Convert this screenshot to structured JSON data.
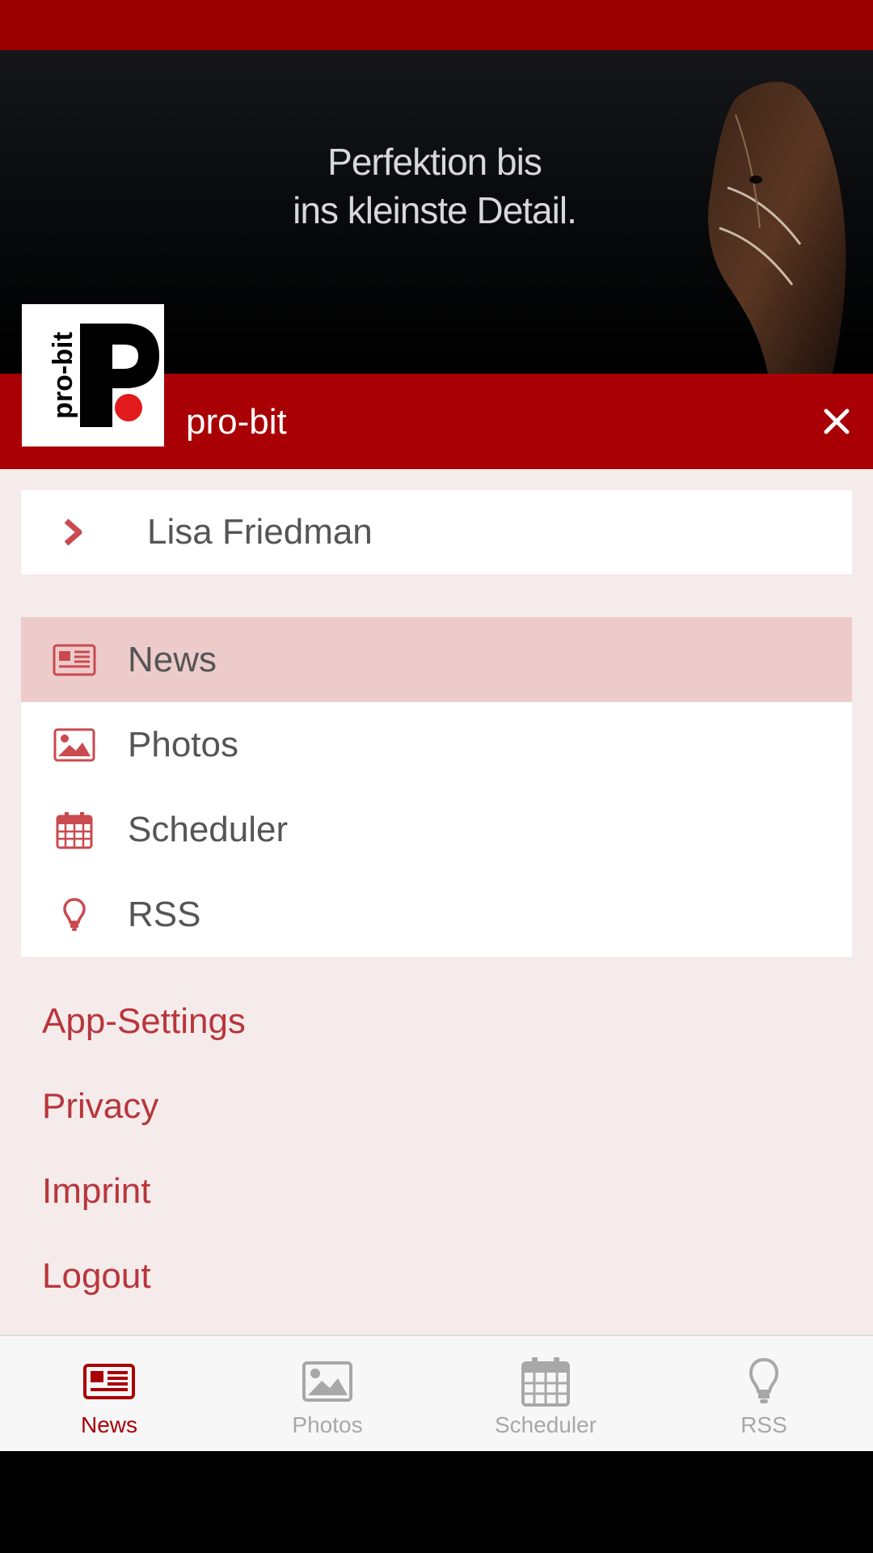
{
  "banner": {
    "tagline_line1": "Perfektion bis",
    "tagline_line2": "ins kleinste Detail."
  },
  "header": {
    "logo_text": "pro-bit",
    "logo_letter": "P",
    "title": "pro-bit",
    "close_icon": "close-icon"
  },
  "user": {
    "name": "Lisa Friedman",
    "icon": "chevron-right-icon"
  },
  "menu": {
    "items": [
      {
        "label": "News",
        "icon": "newspaper-icon",
        "active": true
      },
      {
        "label": "Photos",
        "icon": "image-icon",
        "active": false
      },
      {
        "label": "Scheduler",
        "icon": "calendar-icon",
        "active": false
      },
      {
        "label": "RSS",
        "icon": "lightbulb-icon",
        "active": false
      }
    ]
  },
  "links": {
    "items": [
      {
        "label": "App-Settings"
      },
      {
        "label": "Privacy"
      },
      {
        "label": "Imprint"
      },
      {
        "label": "Logout"
      }
    ]
  },
  "tabbar": {
    "tabs": [
      {
        "label": "News",
        "icon": "newspaper-icon",
        "active": true
      },
      {
        "label": "Photos",
        "icon": "image-icon",
        "active": false
      },
      {
        "label": "Scheduler",
        "icon": "calendar-icon",
        "active": false
      },
      {
        "label": "RSS",
        "icon": "lightbulb-icon",
        "active": false
      }
    ]
  },
  "colors": {
    "brand_red": "#a90005",
    "status_red": "#9b0000",
    "accent_text": "#b8363c",
    "active_row": "#edcbcb",
    "drawer_bg": "#f5ebeb"
  }
}
